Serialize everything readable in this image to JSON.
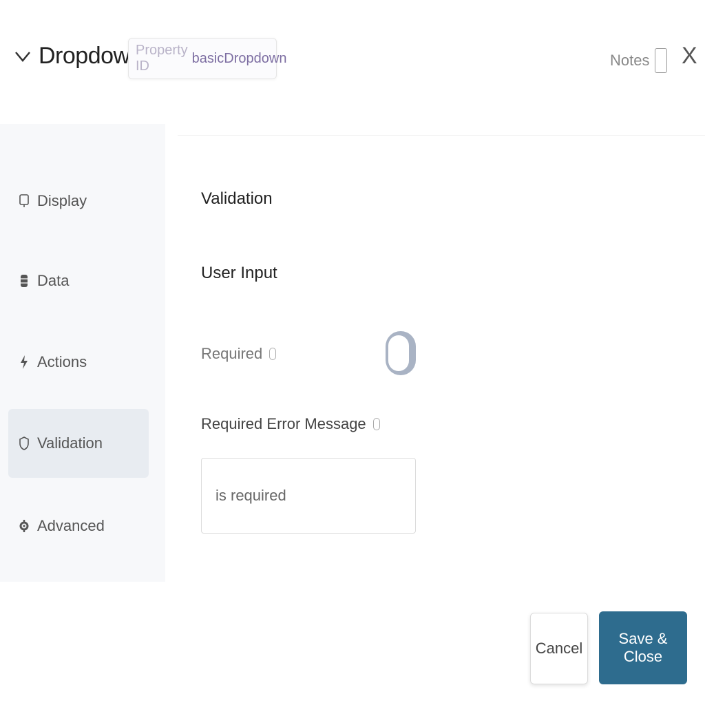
{
  "header": {
    "title": "Dropdown",
    "property_label": "Property ID",
    "property_value": "basicDropdown",
    "notes_label": "Notes",
    "close_label": "X"
  },
  "sidebar": {
    "items": [
      {
        "label": "Display",
        "icon": "monitor-icon",
        "active": false
      },
      {
        "label": "Data",
        "icon": "database-icon",
        "active": false
      },
      {
        "label": "Actions",
        "icon": "lightning-icon",
        "active": false
      },
      {
        "label": "Validation",
        "icon": "shield-icon",
        "active": true
      },
      {
        "label": "Advanced",
        "icon": "gear-icon",
        "active": false
      }
    ]
  },
  "main": {
    "section_title": "Validation",
    "subsection_title": "User Input",
    "required_label": "Required",
    "required_on": false,
    "error_message_label": "Required Error Message",
    "error_message_value": "is required"
  },
  "footer": {
    "cancel_label": "Cancel",
    "save_label": "Save & Close"
  },
  "colors": {
    "primary": "#2e6c8e",
    "sidebar_bg": "#f7f8fa",
    "active_item_bg": "#e8ecf1",
    "toggle_off": "#a9b3c4"
  }
}
